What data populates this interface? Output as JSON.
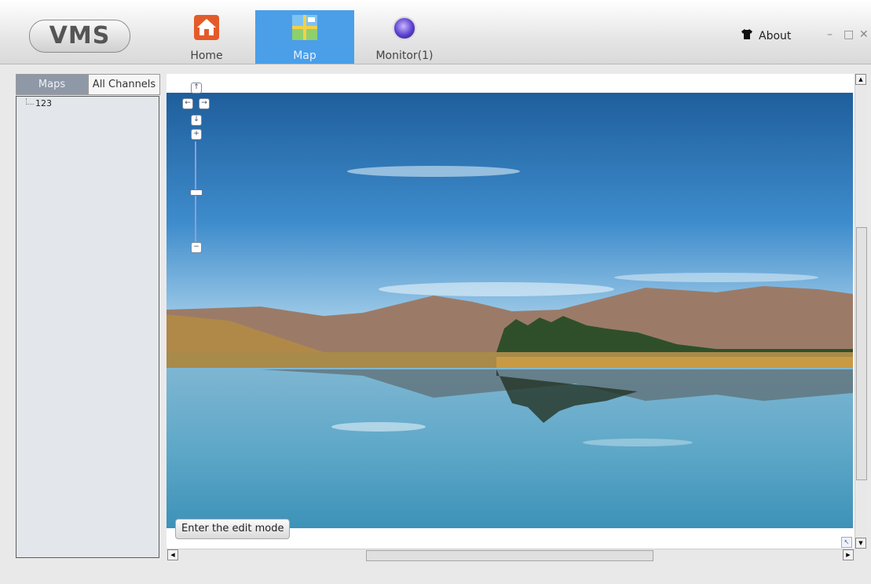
{
  "app": {
    "logo": "VMS"
  },
  "nav": {
    "tabs": [
      {
        "label": "Home",
        "icon": "home-icon",
        "active": false
      },
      {
        "label": "Map",
        "icon": "map-icon",
        "active": true
      },
      {
        "label": "Monitor(1)",
        "icon": "monitor-icon",
        "active": false
      }
    ]
  },
  "header": {
    "about": "About",
    "window_controls": {
      "minimize": "–",
      "maximize": "□",
      "close": "✕"
    }
  },
  "sidebar": {
    "tabs": [
      {
        "label": "Maps",
        "active": true
      },
      {
        "label": "All Channels",
        "active": false
      }
    ],
    "tree": [
      {
        "label": "123"
      }
    ]
  },
  "map": {
    "edit_button": "Enter the edit mode",
    "nav_controls": {
      "up": "↑",
      "left": "←",
      "right": "→",
      "down": "↓",
      "zoom_in": "+",
      "zoom_out": "−"
    }
  },
  "colors": {
    "active_tab": "#4a9fe8",
    "maps_tab": "#8f98a6",
    "home_icon": "#e45b2a"
  }
}
